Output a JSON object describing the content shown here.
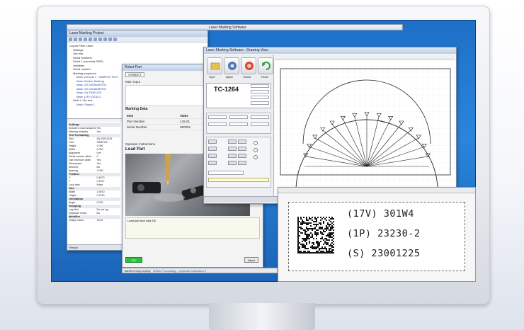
{
  "app": {
    "main_title": "Laser Marking Software",
    "left_window_title": "Laser Marking Project",
    "left_status": "Ready"
  },
  "tree": {
    "items": [
      {
        "label": "Layout Fiber Laser",
        "color": "normal"
      },
      {
        "label": "Settings",
        "color": "normal"
      },
      {
        "label": "Job Info",
        "color": "normal"
      },
      {
        "label": "Serial numbers",
        "color": "normal"
      },
      {
        "label": "Serial 1 (currently 0000)",
        "color": "normal"
      },
      {
        "label": "Variables",
        "color": "normal"
      },
      {
        "label": "Serial number",
        "color": "normal"
      },
      {
        "label": "Marking sequence",
        "color": "normal"
      },
      {
        "label": "Mark: Decode 1 - SAMPLE TEXT",
        "color": "blue"
      },
      {
        "label": "Mark: Marker Marking",
        "color": "blue"
      },
      {
        "label": "Mark: 2D DATAMATRIX",
        "color": "blue"
      },
      {
        "label": "Mark: 2D DATAMATRIX",
        "color": "blue"
      },
      {
        "label": "Mark: (3) 23001225",
        "color": "blue"
      },
      {
        "label": "Mark: (1P) 23230-2",
        "color": "blue"
      },
      {
        "label": "Wait 1 / No text",
        "color": "normal"
      },
      {
        "label": "Mark: Shape 1",
        "color": "blue"
      }
    ]
  },
  "props": {
    "rows": [
      {
        "k": "Settings",
        "v": "",
        "head": true
      },
      {
        "k": "Include in mark sequence",
        "v": "Yes"
      },
      {
        "k": "Marking Indicator",
        "v": "Yes"
      },
      {
        "k": "Text Formatting",
        "v": "",
        "head": true
      },
      {
        "k": "Text",
        "v": "(S) 23001225"
      },
      {
        "k": "Font",
        "v": "SIMPLEX"
      },
      {
        "k": "Height",
        "v": "1.000"
      },
      {
        "k": "Width",
        "v": "0.000"
      },
      {
        "k": "Alignment",
        "v": "Left"
      },
      {
        "k": "Serial number offset",
        "v": "0"
      },
      {
        "k": "Use minimum width",
        "v": "Yes"
      },
      {
        "k": "Monospace",
        "v": "Yes"
      },
      {
        "k": "Mirrored",
        "v": "No"
      },
      {
        "k": "Spacing",
        "v": "1.000"
      },
      {
        "k": "Position",
        "v": "",
        "head": true
      },
      {
        "k": "X",
        "v": "0.4070"
      },
      {
        "k": "Y",
        "v": "0.1917"
      },
      {
        "k": "Lock ratio",
        "v": "False"
      },
      {
        "k": "Size",
        "v": "",
        "head": true
      },
      {
        "k": "Width",
        "v": "1.5870"
      },
      {
        "k": "Height",
        "v": "0.1240"
      },
      {
        "k": "Orientation",
        "v": "",
        "head": true
      },
      {
        "k": "Angle",
        "v": "0.000"
      },
      {
        "k": "Grouping",
        "v": "",
        "head": true
      },
      {
        "k": "Log field",
        "v": "Do not log"
      },
      {
        "k": "Duplicate check",
        "v": "No"
      },
      {
        "k": "Identifier",
        "v": "",
        "head": true
      },
      {
        "k": "Unique name",
        "v": "Text3"
      }
    ]
  },
  "operator": {
    "title": "Robot Part",
    "field_value": "ONNEKT",
    "main_input_label": "Main Input",
    "marking_data_header": "Marking Data",
    "table": [
      {
        "item": "Item",
        "value": "Value"
      },
      {
        "item": "Part Number",
        "value": "LOLOL"
      },
      {
        "item": "Serial Number",
        "value": "000001"
      }
    ],
    "instructions_label": "Operator Instructions",
    "instruction": "Load Part",
    "prompt": "Load part and click Ok.",
    "ok_label": "OK",
    "abort_label": "Abort"
  },
  "drawing": {
    "title": "Laser Marking Software - Drawing View",
    "tc_label": "TC-1264",
    "open_label": "Open",
    "adjust_label": "Adjust",
    "outline_label": "Outline",
    "reset_label": "Reset",
    "button_labels": [
      "Open",
      "Adjust",
      "Outline",
      "Reset"
    ]
  },
  "label": {
    "lines": [
      "(17V) 301W4",
      "(1P) 23230-2",
      "(S) 23001225"
    ]
  },
  "status": {
    "left": "BASIC/Verify Activity",
    "process": "Within Processing... Operator Instruction 1"
  },
  "colors": {
    "screen": "#2a85dc",
    "ok_button": "#28c43c",
    "tree_link": "#2244aa"
  }
}
